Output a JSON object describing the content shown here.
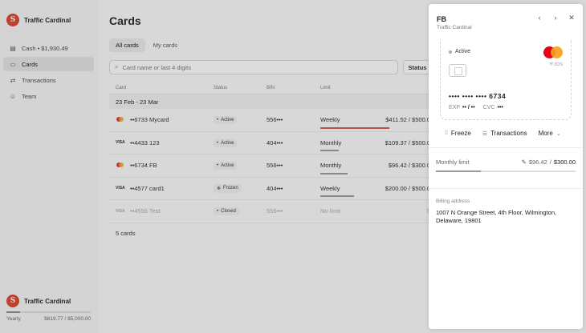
{
  "brand": {
    "name": "Traffic Cardinal",
    "logo_letter": "S"
  },
  "sidebar": {
    "items": [
      {
        "label": "Cash • $1,930.49",
        "icon": "wallet-icon"
      },
      {
        "label": "Cards",
        "icon": "card-icon",
        "active": true
      },
      {
        "label": "Transactions",
        "icon": "swap-icon"
      },
      {
        "label": "Team",
        "icon": "team-icon"
      }
    ],
    "footer": {
      "name": "Traffic Cardinal",
      "plan": "Yearly",
      "usage": "$819.77 / $5,000.00",
      "usage_fraction": 0.16
    }
  },
  "main": {
    "title": "Cards",
    "tabs": [
      "All cards",
      "My cards"
    ],
    "search_placeholder": "Card name or last 4 digits",
    "status_button": "Status",
    "columns": [
      "Card",
      "Status",
      "BIN",
      "Limit"
    ],
    "group": "23 Feb - 23 Mar",
    "rows": [
      {
        "brand": "mastercard",
        "name": "••6733 Mycard",
        "status": "Active",
        "bin": "556•••",
        "limit": "Weekly",
        "amount": "$411.52 / $500.0",
        "fill": 0.82,
        "line_color": "#d9534f"
      },
      {
        "brand": "VISA",
        "name": "••4433 123",
        "status": "Active",
        "bin": "404•••",
        "limit": "Monthly",
        "amount": "$109.37 / $500.0",
        "fill": 0.22,
        "line_color": "#9a9a9a"
      },
      {
        "brand": "mastercard",
        "name": "••6734 FB",
        "status": "Active",
        "bin": "556•••",
        "limit": "Monthly",
        "amount": "$96.42 / $300.0",
        "fill": 0.32,
        "line_color": "#9a9a9a"
      },
      {
        "brand": "VISA",
        "name": "••4577 card1",
        "status": "Frozen",
        "bin": "404•••",
        "limit": "Weekly",
        "amount": "$200.00 / $500.0",
        "fill": 0.4,
        "line_color": "#9a9a9a"
      },
      {
        "brand": "VISA",
        "name": "••4556 Test",
        "status": "Closed",
        "bin": "556•••",
        "limit": "No limit",
        "amount": "$",
        "fill": 0,
        "line_color": "#9a9a9a",
        "dim": true
      }
    ],
    "count": "5 cards"
  },
  "panel": {
    "title": "FB",
    "subtitle": "Traffic Cardinal",
    "card": {
      "status": "Active",
      "secure_label": "3DS",
      "number": "•••• •••• •••• 6734",
      "exp_label": "EXP",
      "exp_value": "•• / ••",
      "cvc_label": "CVC",
      "cvc_value": "•••"
    },
    "actions": {
      "freeze": "Freeze",
      "transactions": "Transactions",
      "more": "More"
    },
    "limit": {
      "label": "Monthly limit",
      "spent": "$96.42",
      "total": "$300.00",
      "fraction": 0.32
    },
    "billing": {
      "label": "Billing address",
      "address": "1007 N Orange Street, 4th Floor, Wilmington, Delaware, 19801"
    }
  }
}
